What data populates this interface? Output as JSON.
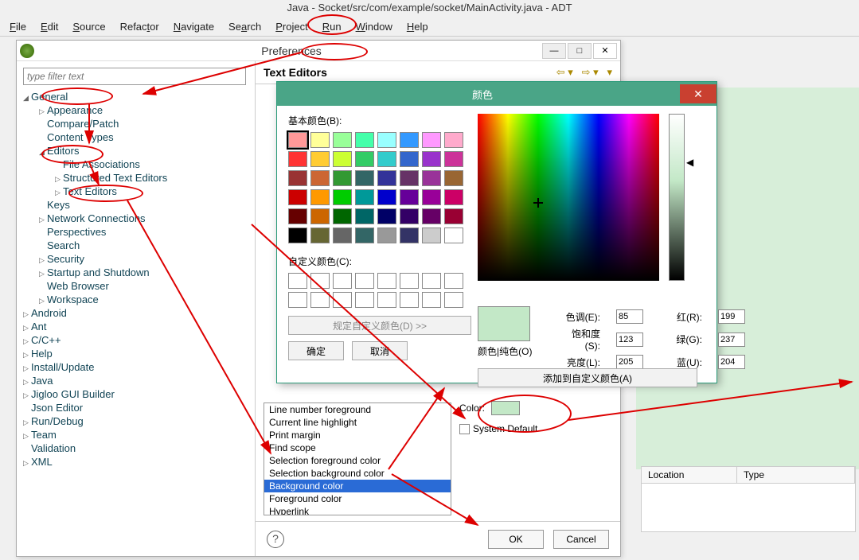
{
  "main_title": "Java - Socket/src/com/example/socket/MainActivity.java - ADT",
  "menubar": [
    "File",
    "Edit",
    "Source",
    "Refactor",
    "Navigate",
    "Search",
    "Project",
    "Run",
    "Window",
    "Help"
  ],
  "prefs": {
    "title": "Preferences",
    "filter_placeholder": "type filter text",
    "heading": "Text Editors",
    "ok": "OK",
    "cancel": "Cancel",
    "color_label": "Color:",
    "system_default": "System Default",
    "tree": {
      "general": "General",
      "appearance": "Appearance",
      "compare": "Compare/Patch",
      "content": "Content Types",
      "editors": "Editors",
      "file_assoc": "File Associations",
      "struct": "Structured Text Editors",
      "text_ed": "Text Editors",
      "keys": "Keys",
      "network": "Network Connections",
      "perspectives": "Perspectives",
      "search": "Search",
      "security": "Security",
      "startup": "Startup and Shutdown",
      "web": "Web Browser",
      "workspace": "Workspace",
      "android": "Android",
      "ant": "Ant",
      "ccpp": "C/C++",
      "help": "Help",
      "install": "Install/Update",
      "java": "Java",
      "jigloo": "Jigloo GUI Builder",
      "json": "Json Editor",
      "rundebug": "Run/Debug",
      "team": "Team",
      "validation": "Validation",
      "xml": "XML"
    },
    "options": [
      "Line number foreground",
      "Current line highlight",
      "Print margin",
      "Find scope",
      "Selection foreground color",
      "Selection background color",
      "Background color",
      "Foreground color",
      "Hyperlink"
    ]
  },
  "colordlg": {
    "title": "颜色",
    "basic_label": "基本颜色(B):",
    "custom_label": "自定义颜色(C):",
    "define_btn": "规定自定义颜色(D) >>",
    "ok": "确定",
    "cancel": "取消",
    "preview_label": "颜色|纯色(O)",
    "hue_label": "色调(E):",
    "sat_label": "饱和度(S):",
    "lum_label": "亮度(L):",
    "red_label": "红(R):",
    "green_label": "绿(G):",
    "blue_label": "蓝(U):",
    "hue": "85",
    "sat": "123",
    "lum": "205",
    "red": "199",
    "green": "237",
    "blue": "204",
    "add_btn": "添加到自定义颜色(A)",
    "basic_colors": [
      "#f99",
      "#ff9",
      "#9f9",
      "#4fa",
      "#9ff",
      "#39f",
      "#f9f",
      "#fac",
      "#f33",
      "#fc3",
      "#cf3",
      "#3c6",
      "#3cc",
      "#36c",
      "#93c",
      "#c39",
      "#933",
      "#c63",
      "#393",
      "#366",
      "#339",
      "#636",
      "#939",
      "#963",
      "#c00",
      "#f90",
      "#0c0",
      "#099",
      "#00c",
      "#609",
      "#909",
      "#c06",
      "#600",
      "#c60",
      "#060",
      "#066",
      "#006",
      "#306",
      "#606",
      "#903",
      "#000",
      "#663",
      "#666",
      "#366",
      "#999",
      "#336",
      "#ccc",
      "#fff"
    ]
  },
  "right_table": {
    "col1": "Location",
    "col2": "Type"
  }
}
